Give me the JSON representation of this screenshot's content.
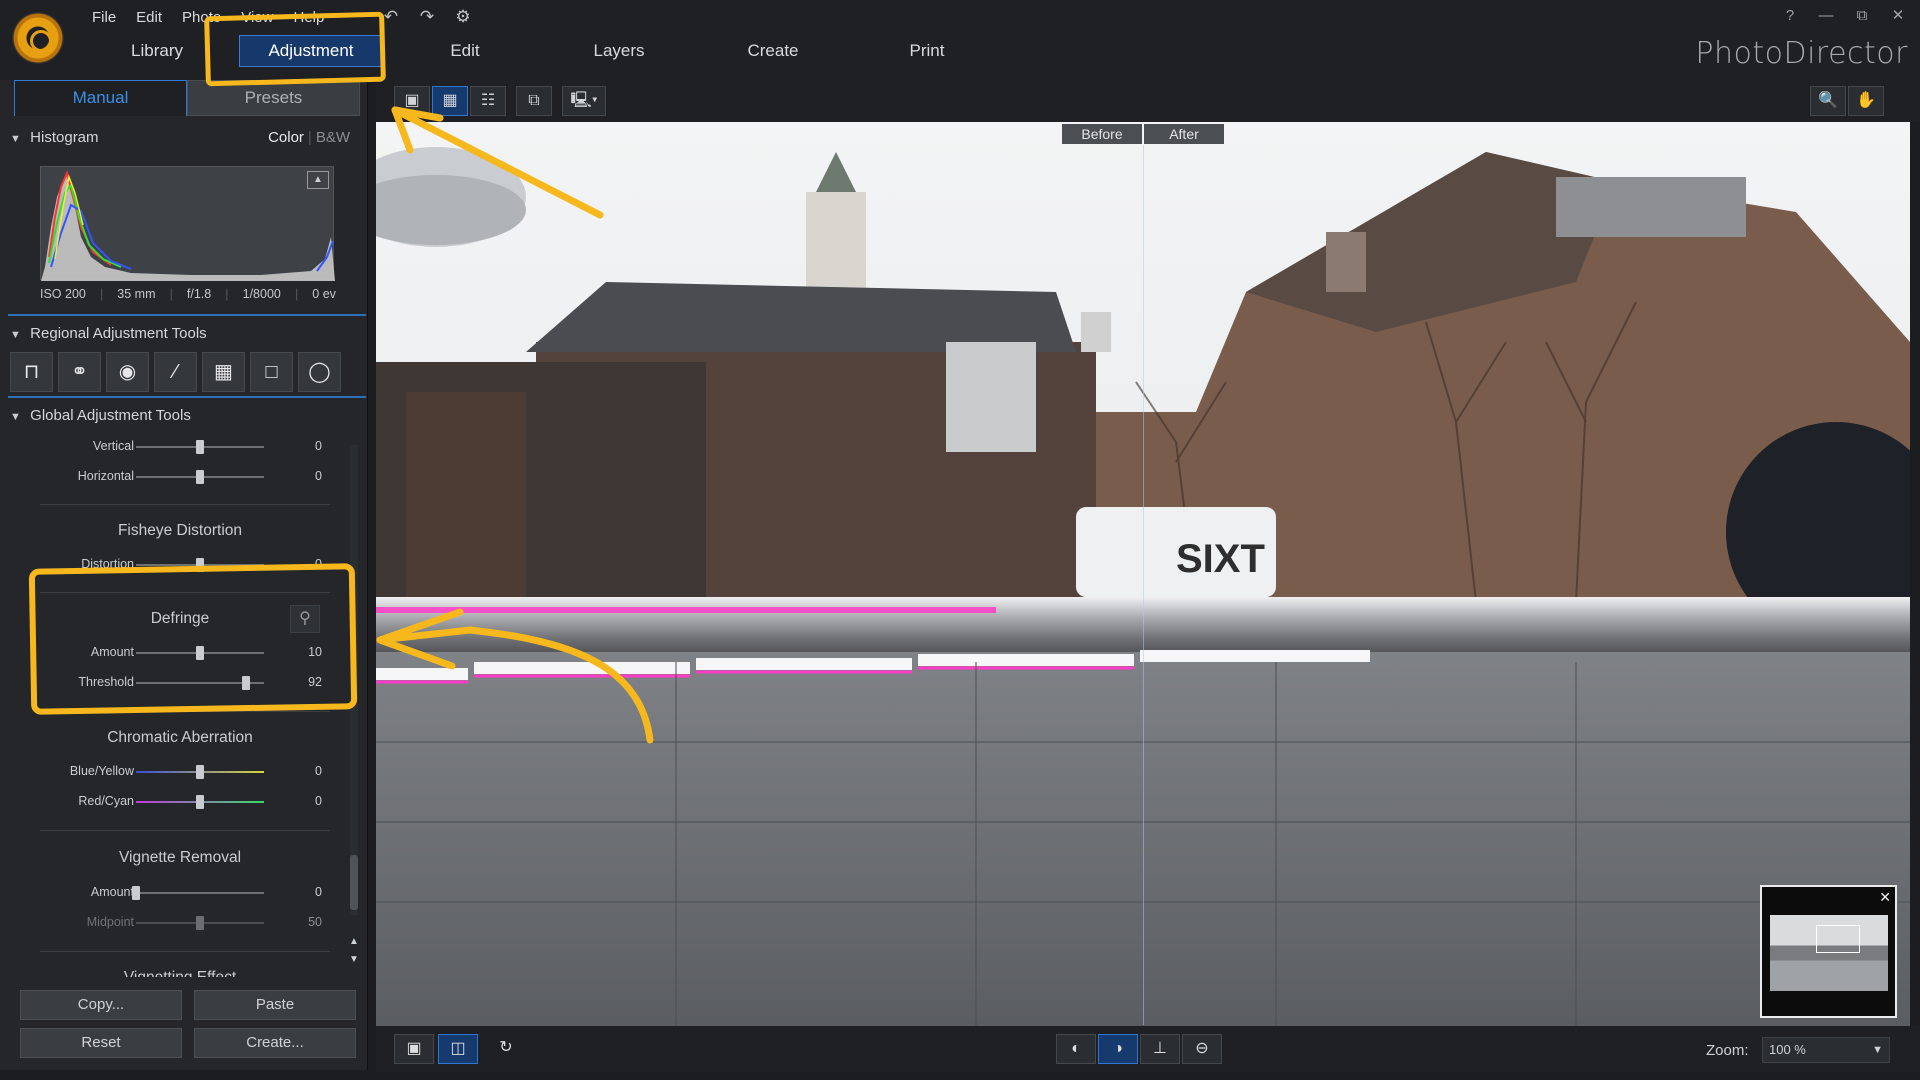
{
  "app": {
    "brand": "PhotoDirector",
    "menu": [
      "File",
      "Edit",
      "Photo",
      "View",
      "Help"
    ],
    "modes": [
      "Library",
      "Adjustment",
      "Edit",
      "Layers",
      "Create",
      "Print"
    ],
    "active_mode": "Adjustment",
    "quick_icons": [
      "undo-icon",
      "redo-icon",
      "settings-icon"
    ],
    "window_controls": {
      "help": "?",
      "minimize": "—",
      "restore": "⧉",
      "close": "✕"
    }
  },
  "panel": {
    "tabs": {
      "manual": "Manual",
      "presets": "Presets"
    },
    "histogram": {
      "title": "Histogram",
      "mode_color": "Color",
      "mode_bw": "B&W",
      "exif": [
        "ISO 200",
        "35 mm",
        "f/1.8",
        "1/8000",
        "0 ev"
      ]
    },
    "regional": {
      "title": "Regional Adjustment Tools",
      "tools": [
        "crop-icon",
        "spot-removal-icon",
        "red-eye-icon",
        "brush-icon",
        "gradient-icon",
        "rectangle-icon",
        "circle-icon"
      ]
    },
    "global": {
      "title": "Global Adjustment Tools",
      "perspective": [
        {
          "label": "Vertical",
          "value": "0",
          "pos": 0.5
        },
        {
          "label": "Horizontal",
          "value": "0",
          "pos": 0.5
        }
      ],
      "fisheye": {
        "title": "Fisheye Distortion",
        "label": "Distortion",
        "value": "0",
        "pos": 0.5
      },
      "defringe": {
        "title": "Defringe",
        "amount": {
          "label": "Amount",
          "value": "10",
          "pos": 0.5
        },
        "threshold": {
          "label": "Threshold",
          "value": "92",
          "pos": 0.86
        }
      },
      "chromatic": {
        "title": "Chromatic Aberration",
        "blue_yellow": {
          "label": "Blue/Yellow",
          "value": "0",
          "pos": 0.5
        },
        "red_cyan": {
          "label": "Red/Cyan",
          "value": "0",
          "pos": 0.5
        }
      },
      "vignette_removal": {
        "title": "Vignette Removal",
        "amount": {
          "label": "Amount",
          "value": "0",
          "pos": 0.0
        },
        "midpoint": {
          "label": "Midpoint",
          "value": "50",
          "pos": 0.5
        }
      },
      "next_section": "Vignetting Effect"
    },
    "actions": {
      "copy": "Copy...",
      "paste": "Paste",
      "reset": "Reset",
      "create": "Create..."
    }
  },
  "viewer": {
    "before": "Before",
    "after": "After",
    "zoom_label": "Zoom:",
    "zoom_value": "100 %",
    "signage": "SIXT"
  },
  "colors": {
    "accent": "#2f7bd9",
    "annotation": "#f7b81e",
    "fringe": "#ff3cc8"
  }
}
